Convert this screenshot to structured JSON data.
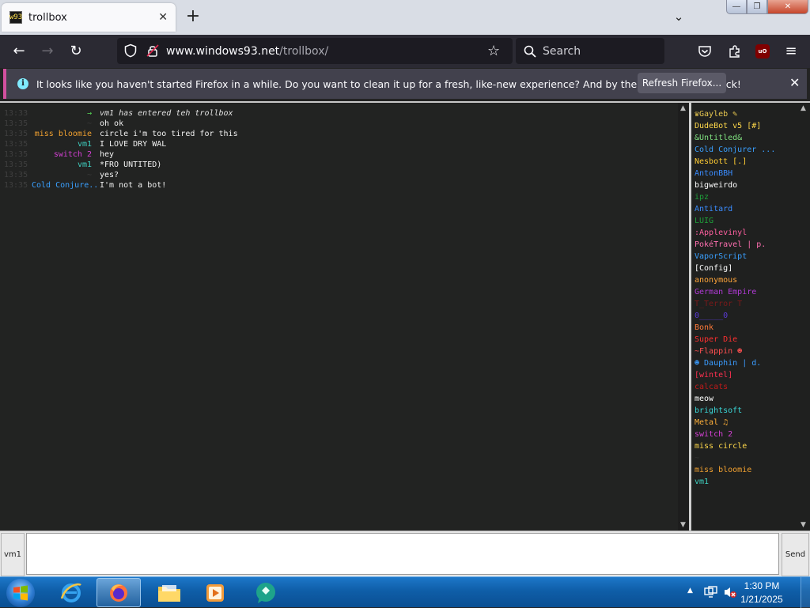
{
  "browser": {
    "tab_title": "trollbox",
    "tab_favicon_text": "w93",
    "url_host": "www.windows93.net",
    "url_path": "/trollbox/",
    "search_placeholder": "Search"
  },
  "notification": {
    "text": "It looks like you haven't started Firefox in a while. Do you want to clean it up for a fresh, like-new experience? And by the way, welcome back!",
    "button_label": "Refresh Firefox..."
  },
  "chat": {
    "messages": [
      {
        "time": "13:33",
        "nick": "→",
        "nick_color": "#55d655",
        "text": "vm1 has entered teh trollbox",
        "system": true
      },
      {
        "time": "13:35",
        "nick": "~",
        "nick_color": "#3a3a3a",
        "text": "oh ok",
        "system": false
      },
      {
        "time": "13:35",
        "nick": "miss bloomie",
        "nick_color": "#f0a030",
        "text": "circle i'm too tired for this",
        "system": false
      },
      {
        "time": "13:35",
        "nick": "vm1",
        "nick_color": "#3fd0c0",
        "text": "I LOVE DRY WAL",
        "system": false
      },
      {
        "time": "13:35",
        "nick": "switch 2",
        "nick_color": "#d640d6",
        "text": " hey",
        "system": false
      },
      {
        "time": "13:35",
        "nick": "vm1",
        "nick_color": "#3fd0c0",
        "text": "*FRO UNTITED)",
        "system": false
      },
      {
        "time": "13:35",
        "nick": "~",
        "nick_color": "#3a3a3a",
        "text": "yes?",
        "system": false
      },
      {
        "time": "13:35",
        "nick": "Cold Conjure...",
        "nick_color": "#3aa0ff",
        "text": "I'm not a bot!",
        "system": false
      }
    ]
  },
  "users": [
    {
      "name": "♛Gayleb ✎",
      "color": "#e8c850"
    },
    {
      "name": "DudeBot v5 [#]",
      "color": "#ffd84a"
    },
    {
      "name": "&Untitled&",
      "color": "#7fe07f"
    },
    {
      "name": "Cold Conjurer ...",
      "color": "#3aa0ff"
    },
    {
      "name": "Nesbott [.]",
      "color": "#ffcc33"
    },
    {
      "name": "AntonBBH",
      "color": "#3a8cff"
    },
    {
      "name": "bigweirdo",
      "color": "#ffffff"
    },
    {
      "name": "ipz",
      "color": "#1f9e3a"
    },
    {
      "name": "Antitard",
      "color": "#3a8cff"
    },
    {
      "name": "LUIG",
      "color": "#1f9e3a"
    },
    {
      "name": ":Applevinyl",
      "color": "#ff5fa0"
    },
    {
      "name": "PokéTravel | p.",
      "color": "#ff6fb0"
    },
    {
      "name": "VaporScript",
      "color": "#3aa0ff"
    },
    {
      "name": "[Config]",
      "color": "#ffffff"
    },
    {
      "name": "anonymous",
      "color": "#ffa53a"
    },
    {
      "name": "German Empire",
      "color": "#b03ad6"
    },
    {
      "name": "T_Terror T",
      "color": "#7a1a1a"
    },
    {
      "name": "0_____0",
      "color": "#5a3ad6"
    },
    {
      "name": "Bonk",
      "color": "#ff7a3a"
    },
    {
      "name": "Super Die",
      "color": "#ff3030"
    },
    {
      "name": "~Flappin ☻",
      "color": "#ff5050"
    },
    {
      "name": "☻ Dauphin | d.",
      "color": "#3a9cff"
    },
    {
      "name": "[wintel]",
      "color": "#ff3050"
    },
    {
      "name": "calcats",
      "color": "#c01a1a"
    },
    {
      "name": "meow",
      "color": "#ffffff"
    },
    {
      "name": "brightsoft",
      "color": "#3ad6d6"
    },
    {
      "name": "Metal ♫",
      "color": "#ffb03a"
    },
    {
      "name": "switch 2",
      "color": "#d640d6"
    },
    {
      "name": "miss circle",
      "color": "#ffd84a"
    },
    {
      "name": "~",
      "color": "#333333"
    },
    {
      "name": "miss bloomie",
      "color": "#f0a030"
    },
    {
      "name": "vm1",
      "color": "#3fd0c0"
    }
  ],
  "input": {
    "nick_label": "vm1",
    "send_label": "Send"
  },
  "taskbar": {
    "time": "1:30 PM",
    "date": "1/21/2025"
  }
}
